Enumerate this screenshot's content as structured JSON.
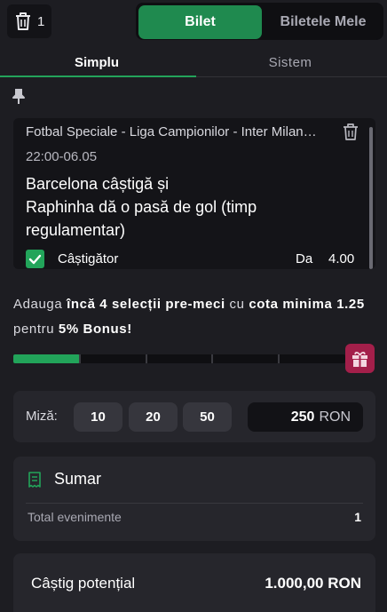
{
  "header": {
    "selection_count": "1",
    "tabs": [
      {
        "label": "Bilet"
      },
      {
        "label": "Biletele Mele"
      }
    ]
  },
  "mode_tabs": [
    {
      "label": "Simplu"
    },
    {
      "label": "Sistem"
    }
  ],
  "selection": {
    "event": "Fotbal Speciale - Liga Campionilor - Inter Milan…",
    "time": "22:00-06.05",
    "market_line1": "Barcelona câștigă și",
    "market_line2": "Raphinha dă o pasă de gol (timp regulamentar)",
    "pick": "Câștigător",
    "answer": "Da",
    "odds": "4.00"
  },
  "promo": {
    "p1": "Adauga ",
    "p2": "încă 4 selecții pre-meci",
    "p3": " cu ",
    "p4": "cota minima 1.25",
    "p5": " pentru ",
    "p6": "5% Bonus!",
    "progress_fraction": 0.2,
    "segments": 5
  },
  "stake": {
    "label": "Miză:",
    "chips": [
      "10",
      "20",
      "50"
    ],
    "amount": "250",
    "currency": "RON"
  },
  "summary": {
    "title": "Sumar",
    "rows": [
      {
        "label": "Total evenimente",
        "value": "1"
      }
    ]
  },
  "potential_win": {
    "label": "Câștig potențial",
    "value": "1.000,00 RON"
  },
  "colors": {
    "accent_green": "#1f8a4f",
    "check_green": "#22a45a",
    "gift_red": "#a31f4a",
    "background": "#1d1d22"
  },
  "icons": [
    "trash-icon",
    "pin-icon",
    "delete-icon",
    "check-icon",
    "gift-icon",
    "receipt-icon"
  ]
}
